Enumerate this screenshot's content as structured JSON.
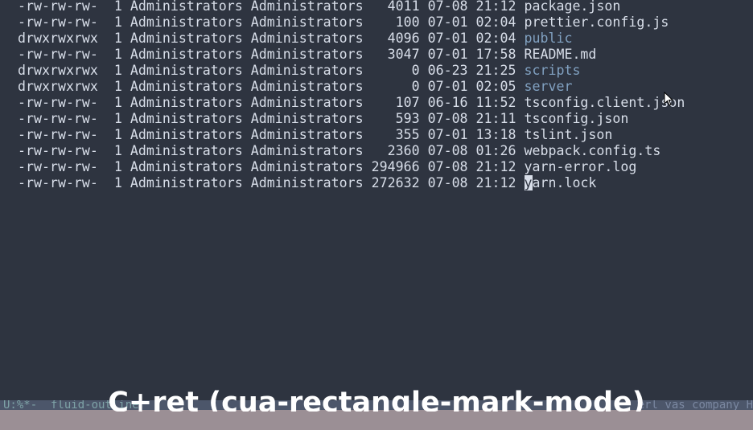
{
  "listing": {
    "rows": [
      {
        "perms": "-rw-rw-rw-",
        "links": "1",
        "owner": "Administrators",
        "group": "Administrators",
        "size": "4011",
        "date": "07-08",
        "time": "21:12",
        "name": "package.json",
        "is_dir": false
      },
      {
        "perms": "-rw-rw-rw-",
        "links": "1",
        "owner": "Administrators",
        "group": "Administrators",
        "size": "100",
        "date": "07-01",
        "time": "02:04",
        "name": "prettier.config.js",
        "is_dir": false
      },
      {
        "perms": "drwxrwxrwx",
        "links": "1",
        "owner": "Administrators",
        "group": "Administrators",
        "size": "4096",
        "date": "07-01",
        "time": "02:04",
        "name": "public",
        "is_dir": true
      },
      {
        "perms": "-rw-rw-rw-",
        "links": "1",
        "owner": "Administrators",
        "group": "Administrators",
        "size": "3047",
        "date": "07-01",
        "time": "17:58",
        "name": "README.md",
        "is_dir": false
      },
      {
        "perms": "drwxrwxrwx",
        "links": "1",
        "owner": "Administrators",
        "group": "Administrators",
        "size": "0",
        "date": "06-23",
        "time": "21:25",
        "name": "scripts",
        "is_dir": true
      },
      {
        "perms": "drwxrwxrwx",
        "links": "1",
        "owner": "Administrators",
        "group": "Administrators",
        "size": "0",
        "date": "07-01",
        "time": "02:05",
        "name": "server",
        "is_dir": true
      },
      {
        "perms": "-rw-rw-rw-",
        "links": "1",
        "owner": "Administrators",
        "group": "Administrators",
        "size": "107",
        "date": "06-16",
        "time": "11:52",
        "name": "tsconfig.client.json",
        "is_dir": false
      },
      {
        "perms": "-rw-rw-rw-",
        "links": "1",
        "owner": "Administrators",
        "group": "Administrators",
        "size": "593",
        "date": "07-08",
        "time": "21:11",
        "name": "tsconfig.json",
        "is_dir": false
      },
      {
        "perms": "-rw-rw-rw-",
        "links": "1",
        "owner": "Administrators",
        "group": "Administrators",
        "size": "355",
        "date": "07-01",
        "time": "13:18",
        "name": "tslint.json",
        "is_dir": false
      },
      {
        "perms": "-rw-rw-rw-",
        "links": "1",
        "owner": "Administrators",
        "group": "Administrators",
        "size": "2360",
        "date": "07-08",
        "time": "01:26",
        "name": "webpack.config.ts",
        "is_dir": false
      },
      {
        "perms": "-rw-rw-rw-",
        "links": "1",
        "owner": "Administrators",
        "group": "Administrators",
        "size": "294966",
        "date": "07-08",
        "time": "21:12",
        "name": "yarn-error.log",
        "is_dir": false
      },
      {
        "perms": "-rw-rw-rw-",
        "links": "1",
        "owner": "Administrators",
        "group": "Administrators",
        "size": "272632",
        "date": "07-08",
        "time": "21:12",
        "name": "yarn.lock",
        "is_dir": false,
        "cursor": true
      }
    ]
  },
  "mode_line": {
    "text": "U:%*-  fluid-outline",
    "right_text": "erl vas company H"
  },
  "caption": "C+ret (cua-rectangle-mark-mode)",
  "colors": {
    "background": "#2e3440",
    "foreground": "#d8dee9",
    "directory": "#81a1c1",
    "mode_line_bg": "#4c566a",
    "echo_area_bg": "#9b8f95"
  }
}
